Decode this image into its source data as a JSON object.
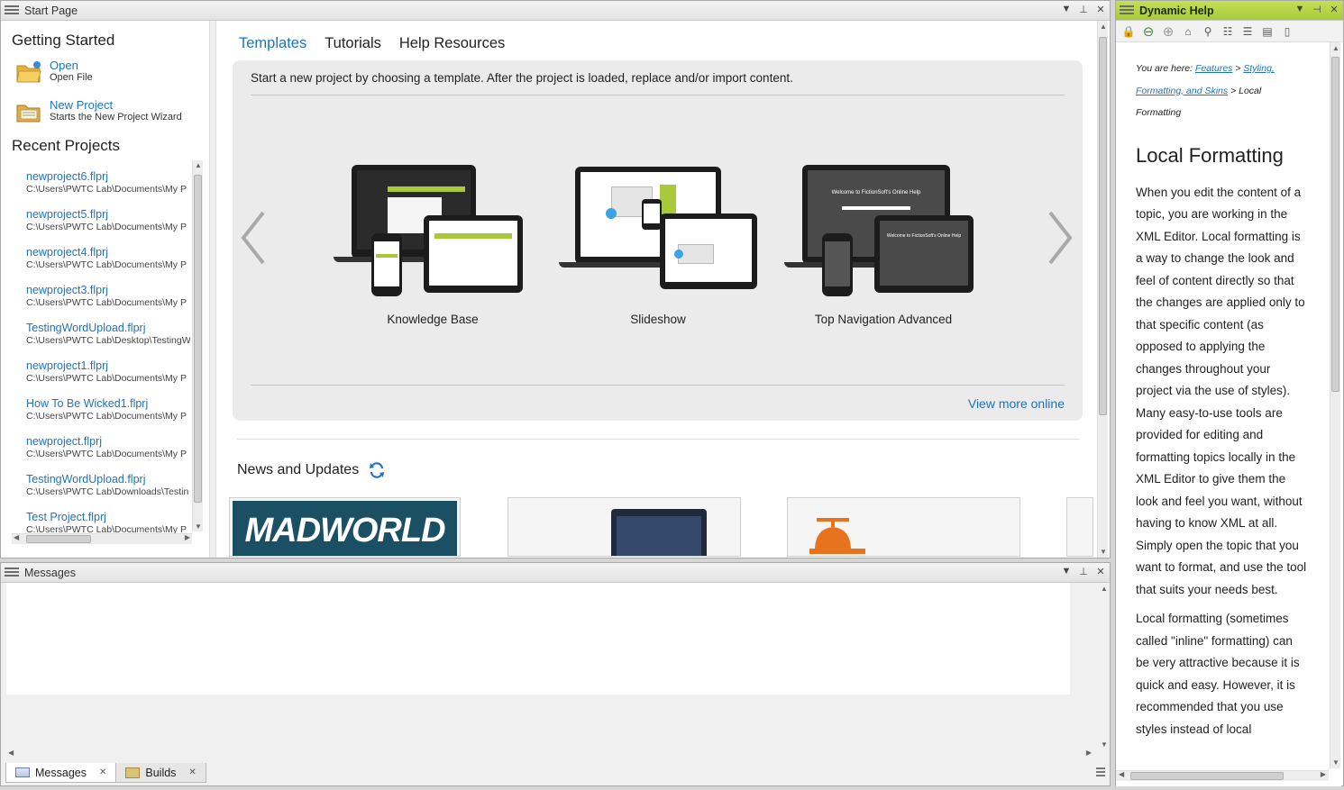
{
  "start_page": {
    "title": "Start Page",
    "getting_started": {
      "heading": "Getting Started",
      "open": {
        "label": "Open",
        "sub": "Open File"
      },
      "new_project": {
        "label": "New Project",
        "sub": "Starts the New Project Wizard"
      }
    },
    "recent": {
      "heading": "Recent Projects",
      "items": [
        {
          "name": "newproject6.flprj",
          "path": "C:\\Users\\PWTC Lab\\Documents\\My P"
        },
        {
          "name": "newproject5.flprj",
          "path": "C:\\Users\\PWTC Lab\\Documents\\My P"
        },
        {
          "name": "newproject4.flprj",
          "path": "C:\\Users\\PWTC Lab\\Documents\\My P"
        },
        {
          "name": "newproject3.flprj",
          "path": "C:\\Users\\PWTC Lab\\Documents\\My P"
        },
        {
          "name": "TestingWordUpload.flprj",
          "path": "C:\\Users\\PWTC Lab\\Desktop\\TestingW"
        },
        {
          "name": "newproject1.flprj",
          "path": "C:\\Users\\PWTC Lab\\Documents\\My P"
        },
        {
          "name": "How To Be Wicked1.flprj",
          "path": "C:\\Users\\PWTC Lab\\Documents\\My P"
        },
        {
          "name": "newproject.flprj",
          "path": "C:\\Users\\PWTC Lab\\Documents\\My P"
        },
        {
          "name": "TestingWordUpload.flprj",
          "path": "C:\\Users\\PWTC Lab\\Downloads\\Testin"
        },
        {
          "name": "Test Project.flprj",
          "path": "C:\\Users\\PWTC Lab\\Documents\\My P"
        }
      ]
    },
    "tabs": [
      "Templates",
      "Tutorials",
      "Help Resources"
    ],
    "templates": {
      "intro": "Start a new project by choosing a template. After the project is loaded, replace and/or import content.",
      "cards": [
        "Knowledge Base",
        "Slideshow",
        "Top Navigation Advanced"
      ],
      "view_more": "View more online",
      "screen_banner": "Welcome to FictionSoft's Online Help"
    },
    "news": {
      "heading": "News and Updates",
      "madworld_logo": "MADWORLD"
    }
  },
  "messages": {
    "title": "Messages",
    "tabs": [
      {
        "label": "Messages"
      },
      {
        "label": "Builds"
      }
    ]
  },
  "dynamic_help": {
    "title": "Dynamic Help",
    "crumb_prefix": "You are here:",
    "crumb_links": [
      "Features",
      "Styling, Formatting, and Skins"
    ],
    "crumb_sep": ">",
    "crumb_current": "Local Formatting",
    "heading": "Local Formatting",
    "para1": "When you edit the content of a topic, you are working in the XML Editor. Local formatting is a way to change the look and feel of content directly so that the changes are applied only to that specific content (as opposed to applying the changes throughout your project via the use of styles). Many easy-to-use tools are provided for editing and formatting topics locally in the XML Editor to give them the look and feel you want, without having to know XML at all. Simply open the topic that you want to format, and use the tool that suits your needs best.",
    "para2": "Local formatting (sometimes called \"inline\" formatting) can be very attractive because it is quick and easy. However, it is recommended that you use styles instead of local"
  },
  "colors": {
    "link": "#1e73be",
    "dynamic_help_title": "#a9c93a"
  }
}
